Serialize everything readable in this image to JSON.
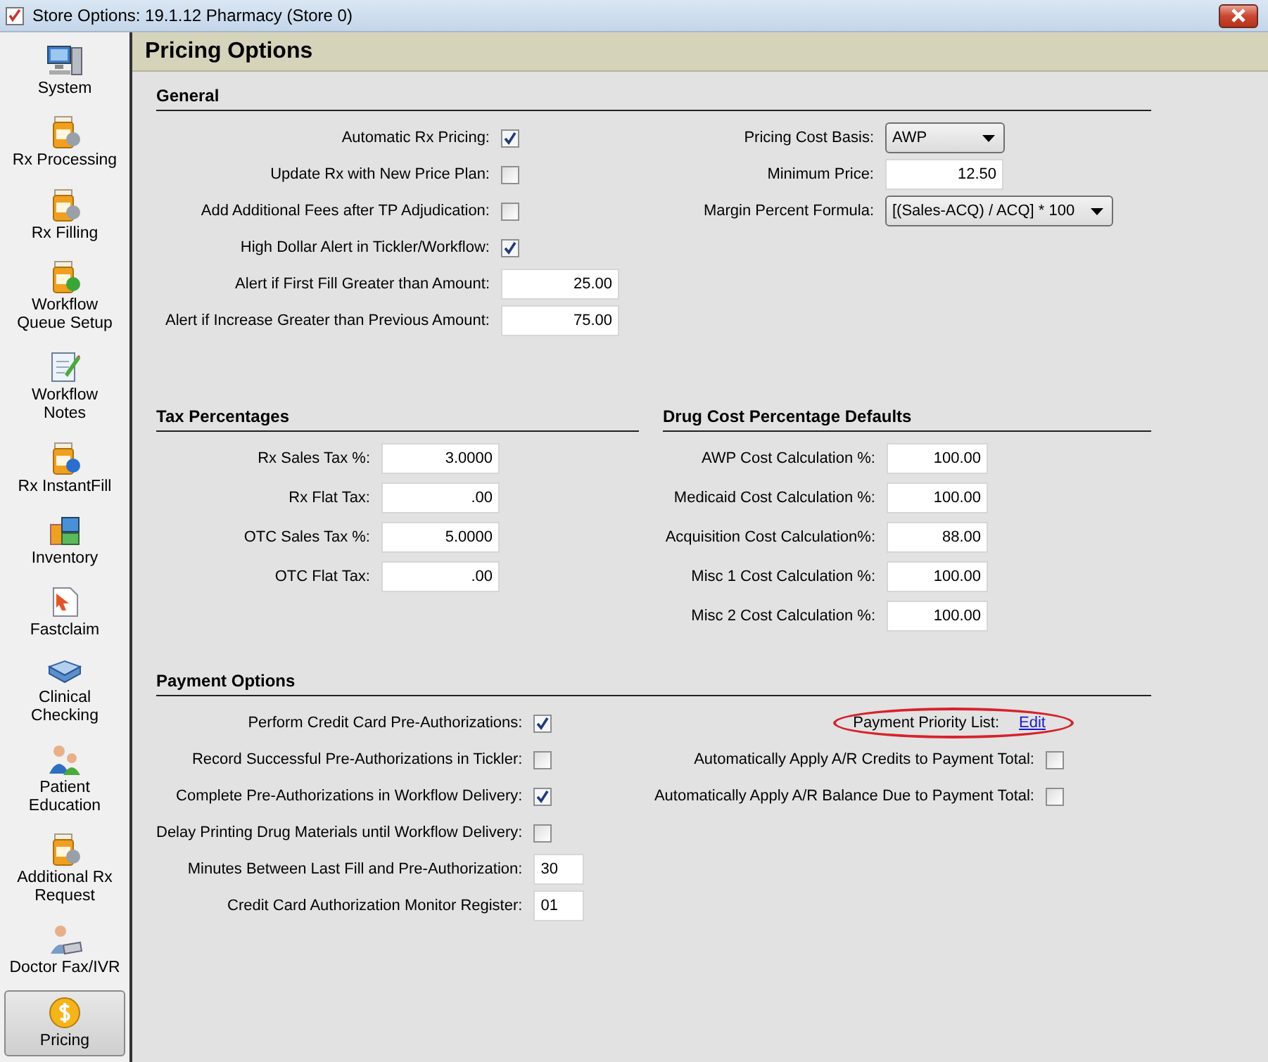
{
  "window": {
    "title": "Store Options: 19.1.12 Pharmacy (Store 0)"
  },
  "sidebar": {
    "items": [
      {
        "label": "System",
        "selected": false
      },
      {
        "label": "Rx Processing",
        "selected": false
      },
      {
        "label": "Rx Filling",
        "selected": false
      },
      {
        "label": "Workflow Queue Setup",
        "selected": false
      },
      {
        "label": "Workflow Notes",
        "selected": false
      },
      {
        "label": "Rx InstantFill",
        "selected": false
      },
      {
        "label": "Inventory",
        "selected": false
      },
      {
        "label": "Fastclaim",
        "selected": false
      },
      {
        "label": "Clinical Checking",
        "selected": false
      },
      {
        "label": "Patient Education",
        "selected": false
      },
      {
        "label": "Additional Rx Request",
        "selected": false
      },
      {
        "label": "Doctor Fax/IVR",
        "selected": false
      },
      {
        "label": "Pricing",
        "selected": true
      }
    ]
  },
  "header": {
    "title": "Pricing Options"
  },
  "general": {
    "title": "General",
    "left": [
      {
        "kind": "checkbox",
        "label": "Automatic Rx Pricing:",
        "checked": true
      },
      {
        "kind": "checkbox",
        "label": "Update Rx with New Price Plan:",
        "checked": false
      },
      {
        "kind": "checkbox",
        "label": "Add Additional Fees after TP Adjudication:",
        "checked": false
      },
      {
        "kind": "checkbox",
        "label": "High Dollar Alert in Tickler/Workflow:",
        "checked": true
      },
      {
        "kind": "number",
        "label": "Alert if First Fill Greater than Amount:",
        "value": "25.00"
      },
      {
        "kind": "number",
        "label": "Alert if Increase Greater than Previous Amount:",
        "value": "75.00"
      }
    ],
    "right": [
      {
        "kind": "dropdown",
        "label": "Pricing Cost Basis:",
        "value": "AWP"
      },
      {
        "kind": "number",
        "label": "Minimum Price:",
        "value": "12.50"
      },
      {
        "kind": "dropdown",
        "label": "Margin Percent Formula:",
        "value": "[(Sales-ACQ) / ACQ] * 100"
      }
    ]
  },
  "tax": {
    "title": "Tax Percentages",
    "rows": [
      {
        "kind": "number",
        "label": "Rx Sales Tax %:",
        "value": "3.0000"
      },
      {
        "kind": "number",
        "label": "Rx Flat Tax:",
        "value": ".00"
      },
      {
        "kind": "number",
        "label": "OTC Sales Tax %:",
        "value": "5.0000"
      },
      {
        "kind": "number",
        "label": "OTC Flat Tax:",
        "value": ".00"
      }
    ]
  },
  "drug_cost": {
    "title": "Drug Cost Percentage Defaults",
    "rows": [
      {
        "kind": "number",
        "label": "AWP Cost Calculation %:",
        "value": "100.00"
      },
      {
        "kind": "number",
        "label": "Medicaid Cost Calculation %:",
        "value": "100.00"
      },
      {
        "kind": "number",
        "label": "Acquisition Cost Calculation%:",
        "value": "88.00"
      },
      {
        "kind": "number",
        "label": "Misc 1 Cost Calculation %:",
        "value": "100.00"
      },
      {
        "kind": "number",
        "label": "Misc 2 Cost Calculation %:",
        "value": "100.00"
      }
    ]
  },
  "payment": {
    "title": "Payment Options",
    "left": [
      {
        "kind": "checkbox",
        "label": "Perform Credit Card Pre-Authorizations:",
        "checked": true
      },
      {
        "kind": "checkbox",
        "label": "Record Successful Pre-Authorizations in Tickler:",
        "checked": false
      },
      {
        "kind": "checkbox",
        "label": "Complete Pre-Authorizations in Workflow Delivery:",
        "checked": true
      },
      {
        "kind": "checkbox",
        "label": "Delay Printing Drug Materials until Workflow Delivery:",
        "checked": false
      },
      {
        "kind": "text",
        "label": "Minutes Between Last Fill and Pre-Authorization:",
        "value": "30"
      },
      {
        "kind": "text",
        "label": "Credit Card Authorization Monitor Register:",
        "value": "01"
      }
    ],
    "right": [
      {
        "kind": "link",
        "label": "Payment Priority List:",
        "link": "Edit",
        "highlighted": true
      },
      {
        "kind": "checkbox",
        "label": "Automatically Apply A/R Credits to Payment Total:",
        "checked": false
      },
      {
        "kind": "checkbox",
        "label": "Automatically Apply A/R Balance Due to Payment Total:",
        "checked": false
      }
    ]
  }
}
